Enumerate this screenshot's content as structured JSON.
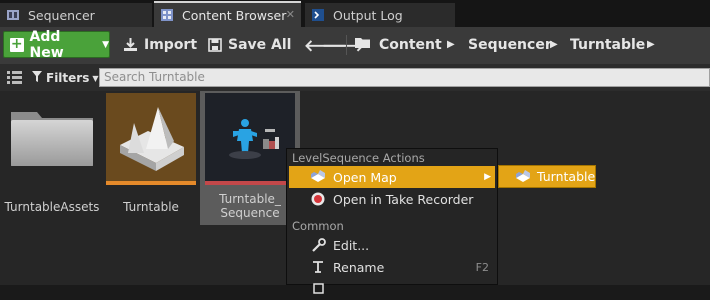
{
  "tabs": [
    {
      "label": "Sequencer"
    },
    {
      "label": "Content Browser"
    },
    {
      "label": "Output Log"
    }
  ],
  "toolbar": {
    "add_new": "Add New",
    "import": "Import",
    "save_all": "Save All",
    "breadcrumbs": [
      "Content",
      "Sequencer",
      "Turntable"
    ]
  },
  "filterbar": {
    "filters": "Filters",
    "search_placeholder": "Search Turntable"
  },
  "assets": [
    {
      "label": "TurntableAssets"
    },
    {
      "label": "Turntable"
    },
    {
      "label_line1": "Turntable_",
      "label_line2": "Sequence"
    }
  ],
  "context_menu": {
    "section1": "LevelSequence Actions",
    "open_map": "Open Map",
    "open_take_recorder": "Open in Take Recorder",
    "section2": "Common",
    "edit": "Edit...",
    "rename": "Rename",
    "rename_shortcut": "F2"
  },
  "submenu": {
    "item": "Turntable"
  },
  "colors": {
    "highlight": "#e3a416",
    "add_new_green": "#4aa23a"
  }
}
